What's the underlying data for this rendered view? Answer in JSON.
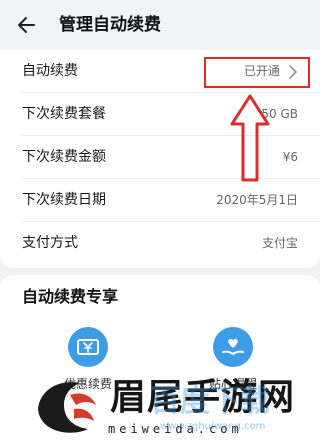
{
  "header": {
    "title": "管理自动续费"
  },
  "settings": {
    "rows": [
      {
        "label": "自动续费",
        "value": "已开通"
      },
      {
        "label": "下次续费套餐",
        "value": "50 GB"
      },
      {
        "label": "下次续费金额",
        "value": "¥6"
      },
      {
        "label": "下次续费日期",
        "value": "2020年5月1日"
      },
      {
        "label": "支付方式",
        "value": "支付宝"
      }
    ]
  },
  "perks": {
    "title": "自动续费专享",
    "items": [
      {
        "label": "优惠续费",
        "icon": "yen-coupon-icon"
      },
      {
        "label": "贴心提醒",
        "icon": "heart-in-hand-icon"
      }
    ]
  },
  "annotation": {
    "box_color": "#e02b2b"
  },
  "watermark": {
    "site_name": "眉尾手游网",
    "url": "meiweida.com",
    "overlay_text": "百度下载",
    "overlay_url": "www.zghuiwang.com"
  },
  "colors": {
    "page_bg": "#f1f3f5",
    "card_bg": "#ffffff",
    "accent": "#3d9ce6",
    "annotation_red": "#e02b2b"
  }
}
